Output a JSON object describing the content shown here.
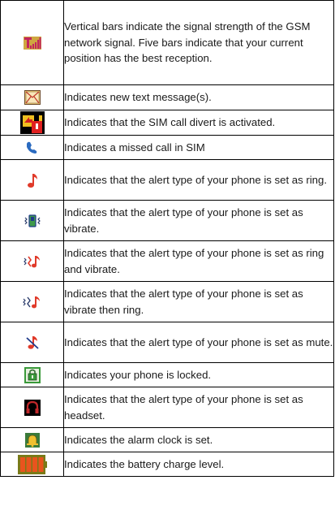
{
  "rows": [
    {
      "icon": "signal-strength-icon",
      "text": "Vertical bars indicate the signal strength of the GSM network signal. Five bars indicate that your current position has the best reception."
    },
    {
      "icon": "envelope-icon",
      "text": "Indicates new text message(s)."
    },
    {
      "icon": "call-divert-icon",
      "text": "Indicates that the SIM call divert is activated."
    },
    {
      "icon": "missed-call-icon",
      "text": "Indicates a missed call in SIM"
    },
    {
      "icon": "ring-icon",
      "text": "Indicates that the alert type of your phone is set as ring."
    },
    {
      "icon": "vibrate-icon",
      "text": "Indicates that the alert type of your phone is set as vibrate."
    },
    {
      "icon": "ring-and-vibrate-icon",
      "text": "Indicates that the alert type of your phone is set as ring and vibrate."
    },
    {
      "icon": "vibrate-then-ring-icon",
      "text": "Indicates that the alert type of your phone is set as vibrate then ring."
    },
    {
      "icon": "mute-icon",
      "text": "Indicates that the alert type of your phone is set as mute."
    },
    {
      "icon": "phone-locked-icon",
      "text": "Indicates your phone is locked."
    },
    {
      "icon": "headset-icon",
      "text": "Indicates that the alert type of your phone is set as headset."
    },
    {
      "icon": "alarm-clock-icon",
      "text": "Indicates the alarm clock is set."
    },
    {
      "icon": "battery-icon",
      "text": "Indicates the battery charge level."
    }
  ]
}
